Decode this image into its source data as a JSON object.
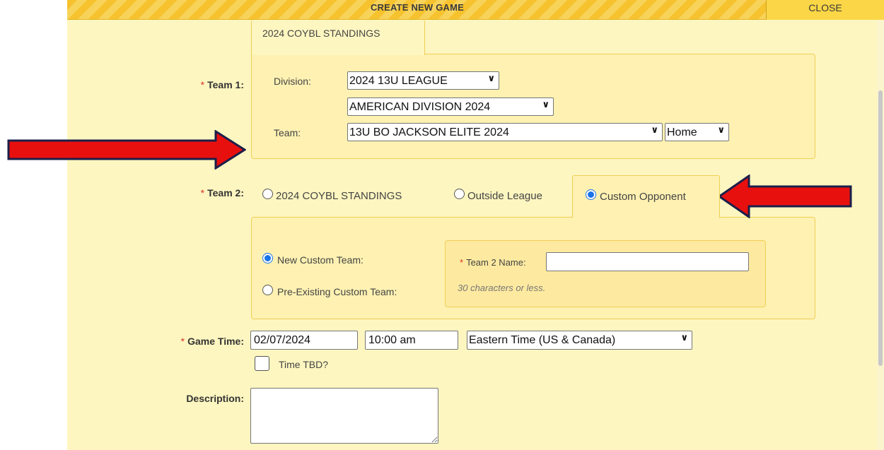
{
  "dialog": {
    "title": "CREATE NEW GAME",
    "close_label": "CLOSE"
  },
  "team1": {
    "label": "Team 1:",
    "tab_label": "2024 COYBL STANDINGS",
    "division_label": "Division:",
    "division_value": "2024 13U LEAGUE",
    "subdivision_value": "AMERICAN DIVISION 2024",
    "team_label": "Team:",
    "team_value": "13U BO JACKSON ELITE 2024",
    "home_away_value": "Home"
  },
  "team2": {
    "label": "Team 2:",
    "options": [
      {
        "label": "2024 COYBL STANDINGS",
        "selected": false
      },
      {
        "label": "Outside League",
        "selected": false
      },
      {
        "label": "Custom Opponent",
        "selected": true
      }
    ],
    "custom_options": [
      {
        "label": "New Custom Team:",
        "selected": true
      },
      {
        "label": "Pre-Existing Custom Team:",
        "selected": false
      }
    ],
    "name_label": "Team 2 Name:",
    "name_value": "",
    "name_hint": "30 characters or less."
  },
  "game_time": {
    "label": "Game Time:",
    "date_value": "02/07/2024",
    "time_value": "10:00 am",
    "timezone_value": "Eastern Time (US & Canada)",
    "tbd_label": "Time TBD?",
    "tbd_checked": false
  },
  "description": {
    "label": "Description:",
    "value": ""
  },
  "required_marker": "*",
  "colors": {
    "dialog_bg": "#fef6c0",
    "panel_bg": "#fef1b2",
    "title_bar": "#f6c22e",
    "required": "#d9342b",
    "arrow_fill": "#e8100f",
    "arrow_stroke": "#1b1f4a",
    "radio_selected": "#1a73e8"
  }
}
